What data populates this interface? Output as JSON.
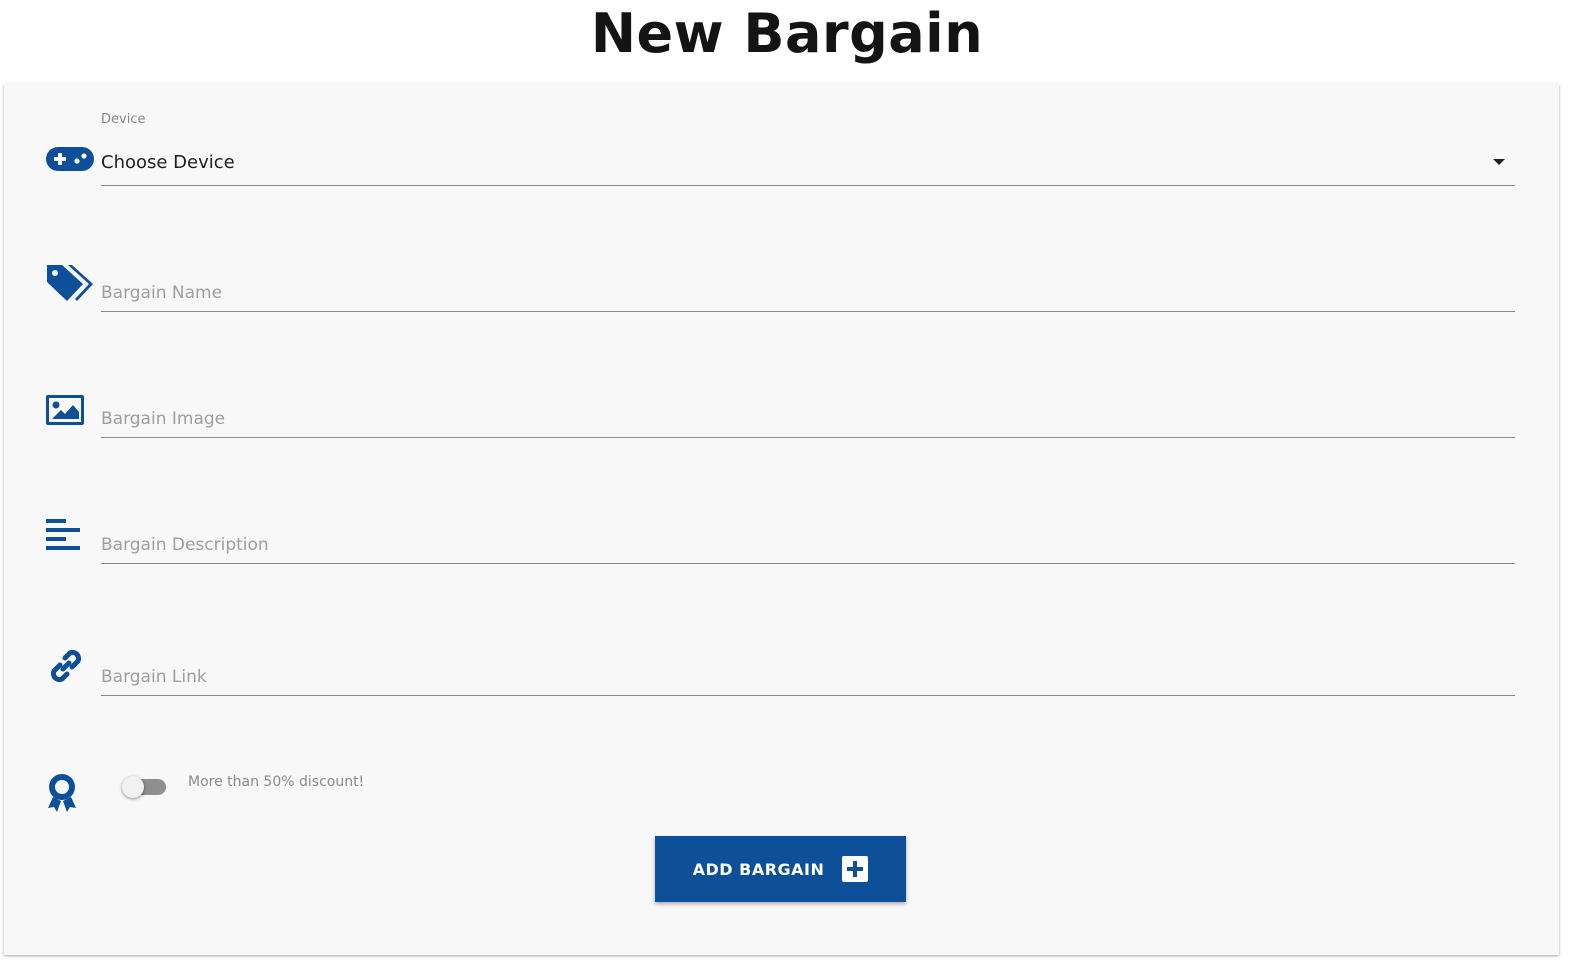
{
  "page": {
    "title": "New Bargain"
  },
  "form": {
    "device": {
      "label": "Device",
      "value": "Choose Device",
      "icon": "gamepad-icon"
    },
    "bargain_name": {
      "placeholder": "Bargain Name",
      "icon": "tags-icon"
    },
    "bargain_image": {
      "placeholder": "Bargain Image",
      "icon": "image-icon"
    },
    "bargain_description": {
      "placeholder": "Bargain Description",
      "icon": "align-left-icon"
    },
    "bargain_link": {
      "placeholder": "Bargain Link",
      "icon": "link-icon"
    },
    "discount_toggle": {
      "label": "More than 50% discount!",
      "checked": false,
      "icon": "award-icon"
    },
    "submit": {
      "label": "ADD BARGAIN",
      "icon": "plus-square-icon"
    }
  },
  "colors": {
    "accent": "#0d4f98",
    "card_background": "#f8f8f8",
    "title_text": "#141414"
  }
}
